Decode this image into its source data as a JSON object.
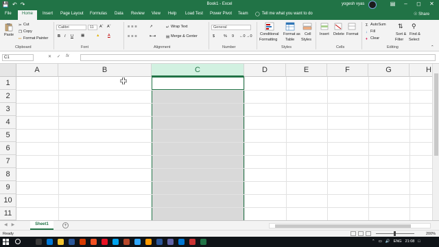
{
  "window": {
    "title": "Book1  -  Excel",
    "user": "yogesh vyas"
  },
  "ribbon_tabs": [
    {
      "label": "File"
    },
    {
      "label": "Home"
    },
    {
      "label": "Insert"
    },
    {
      "label": "Page Layout"
    },
    {
      "label": "Formulas"
    },
    {
      "label": "Data"
    },
    {
      "label": "Review"
    },
    {
      "label": "View"
    },
    {
      "label": "Help"
    },
    {
      "label": "Load Test"
    },
    {
      "label": "Power Pivot"
    },
    {
      "label": "Team"
    }
  ],
  "tell_me": "Tell me what you want to do",
  "share": "Share",
  "clipboard": {
    "paste": "Paste",
    "cut": "Cut",
    "copy": "Copy",
    "format_painter": "Format Painter",
    "label": "Clipboard"
  },
  "font": {
    "name": "Calibri",
    "size": "11",
    "label": "Font",
    "bold": "B",
    "italic": "I",
    "underline": "U"
  },
  "alignment": {
    "wrap_text": "Wrap Text",
    "merge_center": "Merge & Center",
    "label": "Alignment"
  },
  "number": {
    "format": "General",
    "currency": "$",
    "percent": "%",
    "comma": "9",
    "label": "Number"
  },
  "styles": {
    "conditional": [
      "Conditional",
      "Formatting"
    ],
    "format_table": [
      "Format as",
      "Table"
    ],
    "cell_styles": [
      "Cell",
      "Styles"
    ],
    "label": "Styles"
  },
  "cells": {
    "insert": "Insert",
    "delete": "Delete",
    "format": "Format",
    "label": "Cells"
  },
  "editing": {
    "autosum": "AutoSum",
    "fill": "Fill",
    "clear": "Clear",
    "sort_filter": [
      "Sort &",
      "Filter"
    ],
    "find_select": [
      "Find &",
      "Select"
    ],
    "label": "Editing"
  },
  "formula_bar": {
    "name_box": "C1",
    "value": ""
  },
  "columns": [
    "A",
    "B",
    "C",
    "D",
    "E",
    "F",
    "G",
    "H"
  ],
  "rows": [
    "1",
    "2",
    "3",
    "4",
    "5",
    "6",
    "7",
    "8",
    "9",
    "10",
    "11"
  ],
  "selected_column": "C",
  "sheets": [
    {
      "name": "Sheet1"
    }
  ],
  "status": {
    "ready": "Ready",
    "zoom": "200%"
  },
  "taskbar": {
    "lang": "ENG",
    "time": "21:08"
  },
  "colors": {
    "accent": "#217346",
    "selection_fill": "#d9d9d9",
    "header_highlight": "#d2f1e1"
  }
}
